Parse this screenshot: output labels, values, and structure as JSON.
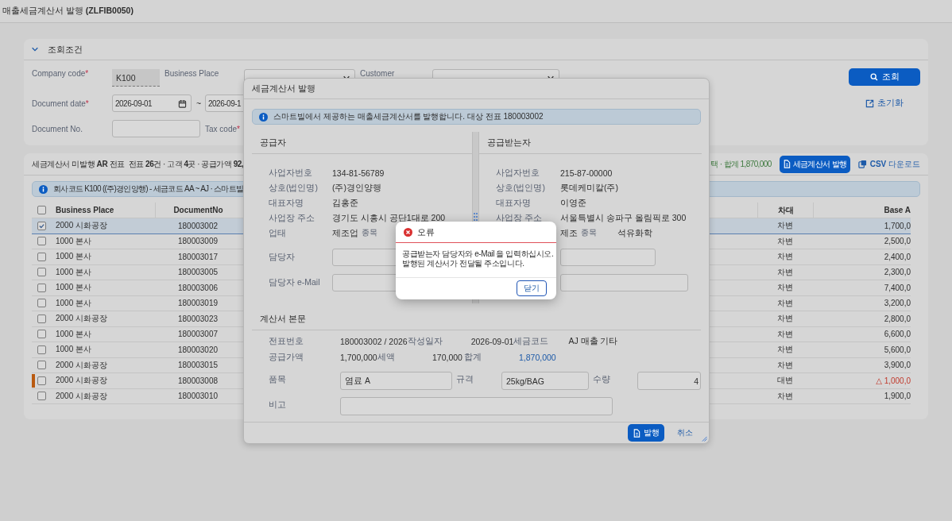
{
  "page_title": "매출세금계산서 발행 **(ZLFIB0050)**",
  "filter": {
    "title": "조회조건",
    "expanded": true,
    "required_mark": "*",
    "rows": [
      [
        {
          "label": "Company code",
          "required": true,
          "kind": "readonly",
          "value": "K100"
        },
        {
          "label": "Business Place",
          "required": false,
          "kind": "dropdown"
        },
        {
          "label": "Customer",
          "required": false,
          "kind": "dropdown"
        }
      ],
      [
        {
          "label": "Document date",
          "required": true,
          "kind": "date_range",
          "value": "2026-09-01",
          "separator": "~",
          "value_to": "2026-09-1"
        }
      ],
      [
        {
          "label": "Document No.",
          "required": false,
          "kind": "text"
        },
        {
          "label": "Tax code",
          "required": true
        }
      ]
    ],
    "search_button": "조회",
    "reset_link": "초기화"
  },
  "table": {
    "title": "세금계산서 미발행 **AR** 전표",
    "summary": "전표 **26**건 · 고객 **4**곳 · 공급가액 **92,**",
    "selection_total": "택 · 합계 1,870,000",
    "issue_button": "세금계산서 발행",
    "csv_link": "**CSV** 다운로드",
    "info": "회사코드 K100 ((주)경인양행) - 세금코드 AA ~ AJ · 스마트빌",
    "all_checked": false,
    "columns": [
      "Business Place",
      "DocumentNo",
      "차대",
      "Base A"
    ],
    "rows": [
      {
        "business_place": "2000 시화공장",
        "document_no": "180003002",
        "dc": "차변",
        "base_amount": "1,700,0",
        "selected": true,
        "checked": true,
        "flagged": false,
        "negative": false
      },
      {
        "business_place": "1000 본사",
        "document_no": "180003009",
        "dc": "차변",
        "base_amount": "2,500,0",
        "selected": false,
        "checked": false,
        "flagged": false,
        "negative": false
      },
      {
        "business_place": "1000 본사",
        "document_no": "180003017",
        "dc": "차변",
        "base_amount": "2,400,0",
        "selected": false,
        "checked": false,
        "flagged": false,
        "negative": false
      },
      {
        "business_place": "1000 본사",
        "document_no": "180003005",
        "dc": "차변",
        "base_amount": "2,300,0",
        "selected": false,
        "checked": false,
        "flagged": false,
        "negative": false
      },
      {
        "business_place": "1000 본사",
        "document_no": "180003006",
        "dc": "차변",
        "base_amount": "7,400,0",
        "selected": false,
        "checked": false,
        "flagged": false,
        "negative": false
      },
      {
        "business_place": "1000 본사",
        "document_no": "180003019",
        "dc": "차변",
        "base_amount": "3,200,0",
        "selected": false,
        "checked": false,
        "flagged": false,
        "negative": false
      },
      {
        "business_place": "2000 시화공장",
        "document_no": "180003023",
        "dc": "차변",
        "base_amount": "2,800,0",
        "selected": false,
        "checked": false,
        "flagged": false,
        "negative": false
      },
      {
        "business_place": "1000 본사",
        "document_no": "180003007",
        "dc": "차변",
        "base_amount": "6,600,0",
        "selected": false,
        "checked": false,
        "flagged": false,
        "negative": false
      },
      {
        "business_place": "1000 본사",
        "document_no": "180003020",
        "dc": "차변",
        "base_amount": "5,600,0",
        "selected": false,
        "checked": false,
        "flagged": false,
        "negative": false
      },
      {
        "business_place": "2000 시화공장",
        "document_no": "180003015",
        "dc": "차변",
        "base_amount": "3,900,0",
        "selected": false,
        "checked": false,
        "flagged": false,
        "negative": false
      },
      {
        "business_place": "2000 시화공장",
        "document_no": "180003008",
        "dc": "대변",
        "base_amount": "△ 1,000,0",
        "selected": false,
        "checked": false,
        "flagged": true,
        "negative": true
      },
      {
        "business_place": "2000 시화공장",
        "document_no": "180003010",
        "dc": "차변",
        "base_amount": "1,900,0",
        "selected": false,
        "checked": false,
        "flagged": false,
        "negative": false
      }
    ]
  },
  "dialog": {
    "title": "세금계산서 발행",
    "info": "스마트빌에서 제공하는 매출세금계산서를 발행합니다. 대상 전표 180003002",
    "supplier": {
      "title": "공급자",
      "rows": [
        {
          "label": "사업자번호",
          "value": "134-81-56789"
        },
        {
          "label": "상호(법인명)",
          "value": "(주)경인양행"
        },
        {
          "label": "대표자명",
          "value": "김홍준"
        },
        {
          "label": "사업장 주소",
          "value": "경기도 시흥시 공단1대로 200"
        },
        {
          "label": "업태",
          "value": "제조업",
          "sub_label": "종목"
        }
      ],
      "contact_fields": [
        {
          "label": "담당자",
          "kind": "text"
        },
        {
          "label": "담당자 e-Mail",
          "kind": "text"
        }
      ]
    },
    "recipient": {
      "title": "공급받는자",
      "rows": [
        {
          "label": "사업자번호",
          "value": "215-87-00000"
        },
        {
          "label": "상호(법인명)",
          "value": "롯데케미칼(주)"
        },
        {
          "label": "대표자명",
          "value": "이영준"
        },
        {
          "label": "사업장 주소",
          "value": "서울특별시 송파구 올림픽로 300"
        },
        {
          "value": "제조",
          "sub_label": "종목",
          "sub_value": "석유화학"
        }
      ],
      "contact_fields": [
        {
          "kind": "text"
        },
        {
          "kind": "text"
        }
      ]
    },
    "body": {
      "title": "계산서 본문",
      "lines": [
        [
          {
            "label": "전표번호",
            "value": "180003002 / 2026",
            "emphasis": false
          },
          {
            "label": "작성일자",
            "value": "2026-09-01",
            "emphasis": false
          },
          {
            "label": "세금코드",
            "value": "AJ 매출 기타",
            "emphasis": false
          }
        ],
        [
          {
            "label": "공급가액",
            "value": "1,700,000",
            "emphasis": false
          },
          {
            "label": "세액",
            "value": "170,000",
            "emphasis": false
          },
          {
            "label": "합계",
            "value": "1,870,000",
            "emphasis": true
          }
        ]
      ],
      "inputs": [
        [
          {
            "label": "품목",
            "value": "염료 A"
          },
          {
            "label": "규격",
            "value": "25kg/BAG"
          },
          {
            "label": "수량",
            "value": "4"
          }
        ],
        [
          {
            "label": "비고"
          }
        ]
      ]
    },
    "issue_button": "발행",
    "cancel_link": "취소"
  },
  "error": {
    "title": "오류",
    "message": "공급받는자 담당자와 e-Mail 을 입력하십시오.\n발행된 계산서가 전달될 주소입니다.",
    "close_button": "닫기"
  }
}
